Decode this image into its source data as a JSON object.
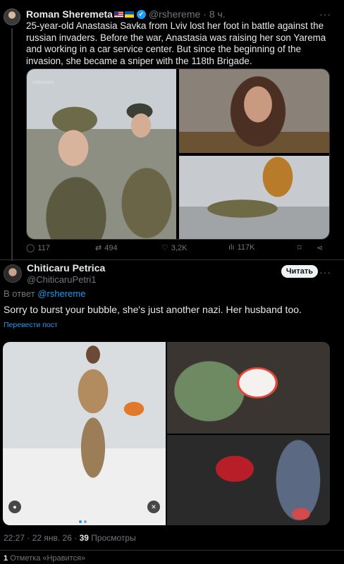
{
  "tweet": {
    "author_name": "Roman Sheremeta",
    "handle": "@rshereme",
    "time": "· 8 ч.",
    "text": "25-year-old Anastasia Savka from Lviv lost her foot in battle against the russian invaders. Before the war, Anastasia was raising her son Yarema and working in a car service center. But since the beginning of the invasion, she became a sniper with the 118th Brigade.",
    "watermark": "Unbroken",
    "actions": {
      "replies": "117",
      "reposts": "494",
      "likes": "3,2K",
      "views": "117K"
    }
  },
  "reply": {
    "author_name": "Chiticaru Petrica",
    "handle": "@ChiticaruPetri1",
    "follow_label": "Читать",
    "reply_prefix": "В ответ",
    "reply_mention": "@rshereme",
    "text": "Sorry to burst your bubble, she's just another nazi. Her husband too.",
    "translate_label": "Перевести пост",
    "timestamp": "22:27 · 22 янв. 26 ·",
    "views_count": "39",
    "views_label": "Просмотры",
    "likes_count": "1",
    "likes_label": "Отметка «Нравится»"
  },
  "colors": {
    "background": "#000000",
    "text": "#e7e9ea",
    "muted": "#71767b",
    "accent": "#1d9bf0"
  }
}
